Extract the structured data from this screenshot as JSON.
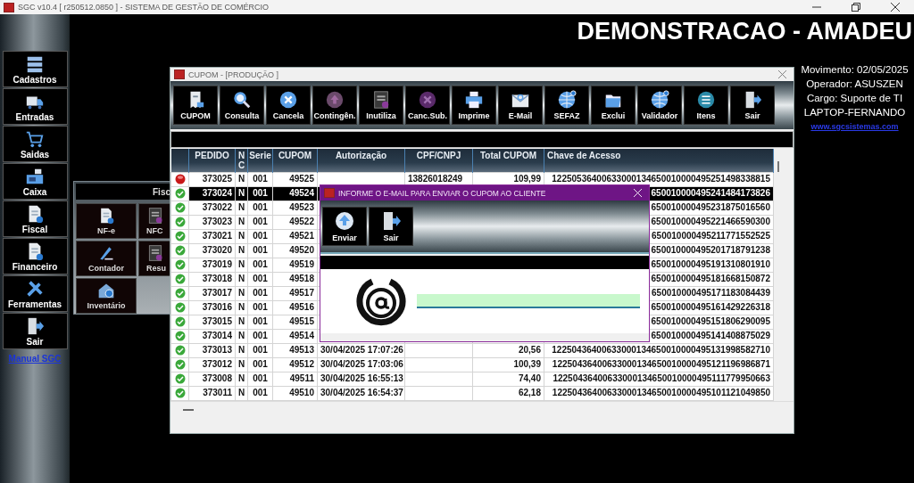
{
  "window": {
    "title": "SGC v10.4 [ r250512.0850 ] - SISTEMA DE GESTÃO DE COMÉRCIO"
  },
  "sidebar": {
    "items": [
      {
        "label": "Cadastros",
        "kind": "stack"
      },
      {
        "label": "Entradas",
        "kind": "truck"
      },
      {
        "label": "Saidas",
        "kind": "cart"
      },
      {
        "label": "Caixa",
        "kind": "register"
      },
      {
        "label": "Fiscal",
        "kind": "doc"
      },
      {
        "label": "Financeiro",
        "kind": "doc"
      },
      {
        "label": "Ferramentas",
        "kind": "tools"
      },
      {
        "label": "Sair",
        "kind": "door"
      }
    ],
    "link": "Manual SGC"
  },
  "company": "DEMONSTRACAO - AMADEU",
  "session": {
    "lines": [
      "Movimento: 02/05/2025",
      "Operador: ASUSZEN",
      "Cargo: Suporte de TI",
      "LAPTOP-FERNANDO"
    ],
    "link": "www.sgcsistemas.com"
  },
  "fiscal_panel": {
    "title": "Fisc",
    "buttons": [
      {
        "label": "NF-e",
        "kind": "doc"
      },
      {
        "label": "NFC",
        "kind": "list"
      },
      {
        "label": "Contador",
        "kind": "pen"
      },
      {
        "label": "Resu",
        "kind": "list"
      },
      {
        "label": "Inventário",
        "kind": "house"
      }
    ]
  },
  "cupom_window": {
    "title": "CUPOM - [PRODUÇÃO   ]",
    "toolbar": [
      {
        "label": "CUPOM",
        "kind": "receipt"
      },
      {
        "label": "Consulta",
        "kind": "search"
      },
      {
        "label": "Cancela",
        "kind": "xcircle"
      },
      {
        "label": "Contingên.",
        "kind": "upcircle"
      },
      {
        "label": "Inutiliza",
        "kind": "list"
      },
      {
        "label": "Canc.Sub.",
        "kind": "xpurple"
      },
      {
        "label": "Imprime",
        "kind": "printer"
      },
      {
        "label": "E-Mail",
        "kind": "mail"
      },
      {
        "label": "SEFAZ",
        "kind": "globe"
      },
      {
        "label": "Exclui",
        "kind": "folder"
      },
      {
        "label": "Validador",
        "kind": "globe"
      },
      {
        "label": "Itens",
        "kind": "listcircle"
      },
      {
        "label": "Sair",
        "kind": "door"
      }
    ],
    "table": {
      "columns": [
        "PEDIDO",
        "N C",
        "Serie",
        "CUPOM",
        "Autorização",
        "CPF/CNPJ",
        "Total CUPOM",
        "Chave de Acesso"
      ],
      "rows": [
        {
          "error": true,
          "selected": false,
          "pedido": "373025",
          "nc": "N",
          "serie": "001",
          "cupom": "49525",
          "cpf_cnpj": "13826018249",
          "total": "109,99",
          "chave": "12250536400633000134650010000495251498338815"
        },
        {
          "error": false,
          "selected": true,
          "pedido": "373024",
          "nc": "N",
          "serie": "001",
          "cupom": "49524",
          "chave": "650010000495241484173826"
        },
        {
          "error": false,
          "selected": false,
          "pedido": "373022",
          "nc": "N",
          "serie": "001",
          "cupom": "49523",
          "chave": "650010000495231875016560"
        },
        {
          "error": false,
          "selected": false,
          "pedido": "373023",
          "nc": "N",
          "serie": "001",
          "cupom": "49522",
          "chave": "650010000495221466590300"
        },
        {
          "error": false,
          "selected": false,
          "pedido": "373021",
          "nc": "N",
          "serie": "001",
          "cupom": "49521",
          "chave": "650010000495211771552525"
        },
        {
          "error": false,
          "selected": false,
          "pedido": "373020",
          "nc": "N",
          "serie": "001",
          "cupom": "49520",
          "chave": "650010000495201718791238"
        },
        {
          "error": false,
          "selected": false,
          "pedido": "373019",
          "nc": "N",
          "serie": "001",
          "cupom": "49519",
          "chave": "650010000495191310801910"
        },
        {
          "error": false,
          "selected": false,
          "pedido": "373018",
          "nc": "N",
          "serie": "001",
          "cupom": "49518",
          "chave": "650010000495181668150872"
        },
        {
          "error": false,
          "selected": false,
          "pedido": "373017",
          "nc": "N",
          "serie": "001",
          "cupom": "49517",
          "chave": "650010000495171183084439"
        },
        {
          "error": false,
          "selected": false,
          "pedido": "373016",
          "nc": "N",
          "serie": "001",
          "cupom": "49516",
          "chave": "650010000495161429226318"
        },
        {
          "error": false,
          "selected": false,
          "pedido": "373015",
          "nc": "N",
          "serie": "001",
          "cupom": "49515",
          "chave": "650010000495151806290095"
        },
        {
          "error": false,
          "selected": false,
          "pedido": "373014",
          "nc": "N",
          "serie": "001",
          "cupom": "49514",
          "chave": "650010000495141408875029"
        },
        {
          "error": false,
          "selected": false,
          "pedido": "373013",
          "nc": "N",
          "serie": "001",
          "cupom": "49513",
          "autorizacao": "30/04/2025 17:07:26",
          "total": "20,56",
          "chave": "12250436400633000134650010000495131998582710"
        },
        {
          "error": false,
          "selected": false,
          "pedido": "373012",
          "nc": "N",
          "serie": "001",
          "cupom": "49512",
          "autorizacao": "30/04/2025 17:03:06",
          "total": "100,39",
          "chave": "12250436400633000134650010000495121196986871"
        },
        {
          "error": false,
          "selected": false,
          "pedido": "373008",
          "nc": "N",
          "serie": "001",
          "cupom": "49511",
          "autorizacao": "30/04/2025 16:55:13",
          "total": "74,40",
          "chave": "12250436400633000134650010000495111779950663"
        },
        {
          "error": false,
          "selected": false,
          "pedido": "373011",
          "nc": "N",
          "serie": "001",
          "cupom": "49510",
          "autorizacao": "30/04/2025 16:54:37",
          "total": "62,18",
          "chave": "12250436400633000134650010000495101121049850"
        }
      ]
    }
  },
  "email_dialog": {
    "title": "INFORME O E-MAIL PARA ENVIAR O CUPOM AO CLIENTE",
    "buttons": [
      {
        "label": "Enviar",
        "kind": "upcircle_blue"
      },
      {
        "label": "Sair",
        "kind": "door"
      }
    ]
  }
}
